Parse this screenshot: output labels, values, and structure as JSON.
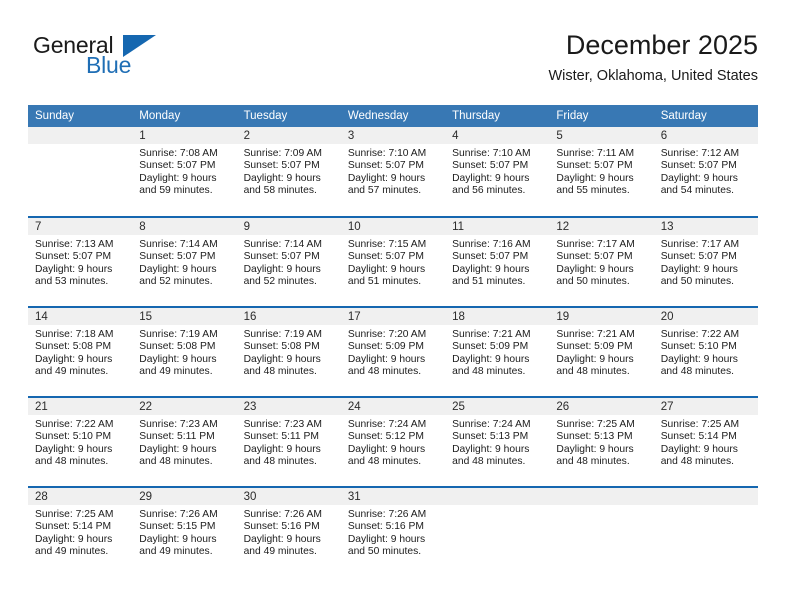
{
  "brand": {
    "name_part1": "General",
    "name_part2": "Blue",
    "logo_icon": "triangle-mark"
  },
  "header": {
    "title": "December 2025",
    "subtitle": "Wister, Oklahoma, United States"
  },
  "calendar": {
    "weekday_headers": [
      "Sunday",
      "Monday",
      "Tuesday",
      "Wednesday",
      "Thursday",
      "Friday",
      "Saturday"
    ],
    "accent_color": "#1567b0",
    "header_bg_color": "#3878b4",
    "daynum_bg_color": "#f0f0f0",
    "weeks": [
      [
        {
          "empty": true
        },
        {
          "day": "1",
          "sunrise": "Sunrise: 7:08 AM",
          "sunset": "Sunset: 5:07 PM",
          "daylight_line1": "Daylight: 9 hours",
          "daylight_line2": "and 59 minutes."
        },
        {
          "day": "2",
          "sunrise": "Sunrise: 7:09 AM",
          "sunset": "Sunset: 5:07 PM",
          "daylight_line1": "Daylight: 9 hours",
          "daylight_line2": "and 58 minutes."
        },
        {
          "day": "3",
          "sunrise": "Sunrise: 7:10 AM",
          "sunset": "Sunset: 5:07 PM",
          "daylight_line1": "Daylight: 9 hours",
          "daylight_line2": "and 57 minutes."
        },
        {
          "day": "4",
          "sunrise": "Sunrise: 7:10 AM",
          "sunset": "Sunset: 5:07 PM",
          "daylight_line1": "Daylight: 9 hours",
          "daylight_line2": "and 56 minutes."
        },
        {
          "day": "5",
          "sunrise": "Sunrise: 7:11 AM",
          "sunset": "Sunset: 5:07 PM",
          "daylight_line1": "Daylight: 9 hours",
          "daylight_line2": "and 55 minutes."
        },
        {
          "day": "6",
          "sunrise": "Sunrise: 7:12 AM",
          "sunset": "Sunset: 5:07 PM",
          "daylight_line1": "Daylight: 9 hours",
          "daylight_line2": "and 54 minutes."
        }
      ],
      [
        {
          "day": "7",
          "sunrise": "Sunrise: 7:13 AM",
          "sunset": "Sunset: 5:07 PM",
          "daylight_line1": "Daylight: 9 hours",
          "daylight_line2": "and 53 minutes."
        },
        {
          "day": "8",
          "sunrise": "Sunrise: 7:14 AM",
          "sunset": "Sunset: 5:07 PM",
          "daylight_line1": "Daylight: 9 hours",
          "daylight_line2": "and 52 minutes."
        },
        {
          "day": "9",
          "sunrise": "Sunrise: 7:14 AM",
          "sunset": "Sunset: 5:07 PM",
          "daylight_line1": "Daylight: 9 hours",
          "daylight_line2": "and 52 minutes."
        },
        {
          "day": "10",
          "sunrise": "Sunrise: 7:15 AM",
          "sunset": "Sunset: 5:07 PM",
          "daylight_line1": "Daylight: 9 hours",
          "daylight_line2": "and 51 minutes."
        },
        {
          "day": "11",
          "sunrise": "Sunrise: 7:16 AM",
          "sunset": "Sunset: 5:07 PM",
          "daylight_line1": "Daylight: 9 hours",
          "daylight_line2": "and 51 minutes."
        },
        {
          "day": "12",
          "sunrise": "Sunrise: 7:17 AM",
          "sunset": "Sunset: 5:07 PM",
          "daylight_line1": "Daylight: 9 hours",
          "daylight_line2": "and 50 minutes."
        },
        {
          "day": "13",
          "sunrise": "Sunrise: 7:17 AM",
          "sunset": "Sunset: 5:07 PM",
          "daylight_line1": "Daylight: 9 hours",
          "daylight_line2": "and 50 minutes."
        }
      ],
      [
        {
          "day": "14",
          "sunrise": "Sunrise: 7:18 AM",
          "sunset": "Sunset: 5:08 PM",
          "daylight_line1": "Daylight: 9 hours",
          "daylight_line2": "and 49 minutes."
        },
        {
          "day": "15",
          "sunrise": "Sunrise: 7:19 AM",
          "sunset": "Sunset: 5:08 PM",
          "daylight_line1": "Daylight: 9 hours",
          "daylight_line2": "and 49 minutes."
        },
        {
          "day": "16",
          "sunrise": "Sunrise: 7:19 AM",
          "sunset": "Sunset: 5:08 PM",
          "daylight_line1": "Daylight: 9 hours",
          "daylight_line2": "and 48 minutes."
        },
        {
          "day": "17",
          "sunrise": "Sunrise: 7:20 AM",
          "sunset": "Sunset: 5:09 PM",
          "daylight_line1": "Daylight: 9 hours",
          "daylight_line2": "and 48 minutes."
        },
        {
          "day": "18",
          "sunrise": "Sunrise: 7:21 AM",
          "sunset": "Sunset: 5:09 PM",
          "daylight_line1": "Daylight: 9 hours",
          "daylight_line2": "and 48 minutes."
        },
        {
          "day": "19",
          "sunrise": "Sunrise: 7:21 AM",
          "sunset": "Sunset: 5:09 PM",
          "daylight_line1": "Daylight: 9 hours",
          "daylight_line2": "and 48 minutes."
        },
        {
          "day": "20",
          "sunrise": "Sunrise: 7:22 AM",
          "sunset": "Sunset: 5:10 PM",
          "daylight_line1": "Daylight: 9 hours",
          "daylight_line2": "and 48 minutes."
        }
      ],
      [
        {
          "day": "21",
          "sunrise": "Sunrise: 7:22 AM",
          "sunset": "Sunset: 5:10 PM",
          "daylight_line1": "Daylight: 9 hours",
          "daylight_line2": "and 48 minutes."
        },
        {
          "day": "22",
          "sunrise": "Sunrise: 7:23 AM",
          "sunset": "Sunset: 5:11 PM",
          "daylight_line1": "Daylight: 9 hours",
          "daylight_line2": "and 48 minutes."
        },
        {
          "day": "23",
          "sunrise": "Sunrise: 7:23 AM",
          "sunset": "Sunset: 5:11 PM",
          "daylight_line1": "Daylight: 9 hours",
          "daylight_line2": "and 48 minutes."
        },
        {
          "day": "24",
          "sunrise": "Sunrise: 7:24 AM",
          "sunset": "Sunset: 5:12 PM",
          "daylight_line1": "Daylight: 9 hours",
          "daylight_line2": "and 48 minutes."
        },
        {
          "day": "25",
          "sunrise": "Sunrise: 7:24 AM",
          "sunset": "Sunset: 5:13 PM",
          "daylight_line1": "Daylight: 9 hours",
          "daylight_line2": "and 48 minutes."
        },
        {
          "day": "26",
          "sunrise": "Sunrise: 7:25 AM",
          "sunset": "Sunset: 5:13 PM",
          "daylight_line1": "Daylight: 9 hours",
          "daylight_line2": "and 48 minutes."
        },
        {
          "day": "27",
          "sunrise": "Sunrise: 7:25 AM",
          "sunset": "Sunset: 5:14 PM",
          "daylight_line1": "Daylight: 9 hours",
          "daylight_line2": "and 48 minutes."
        }
      ],
      [
        {
          "day": "28",
          "sunrise": "Sunrise: 7:25 AM",
          "sunset": "Sunset: 5:14 PM",
          "daylight_line1": "Daylight: 9 hours",
          "daylight_line2": "and 49 minutes."
        },
        {
          "day": "29",
          "sunrise": "Sunrise: 7:26 AM",
          "sunset": "Sunset: 5:15 PM",
          "daylight_line1": "Daylight: 9 hours",
          "daylight_line2": "and 49 minutes."
        },
        {
          "day": "30",
          "sunrise": "Sunrise: 7:26 AM",
          "sunset": "Sunset: 5:16 PM",
          "daylight_line1": "Daylight: 9 hours",
          "daylight_line2": "and 49 minutes."
        },
        {
          "day": "31",
          "sunrise": "Sunrise: 7:26 AM",
          "sunset": "Sunset: 5:16 PM",
          "daylight_line1": "Daylight: 9 hours",
          "daylight_line2": "and 50 minutes."
        },
        {
          "empty": true
        },
        {
          "empty": true
        },
        {
          "empty": true
        }
      ]
    ]
  }
}
